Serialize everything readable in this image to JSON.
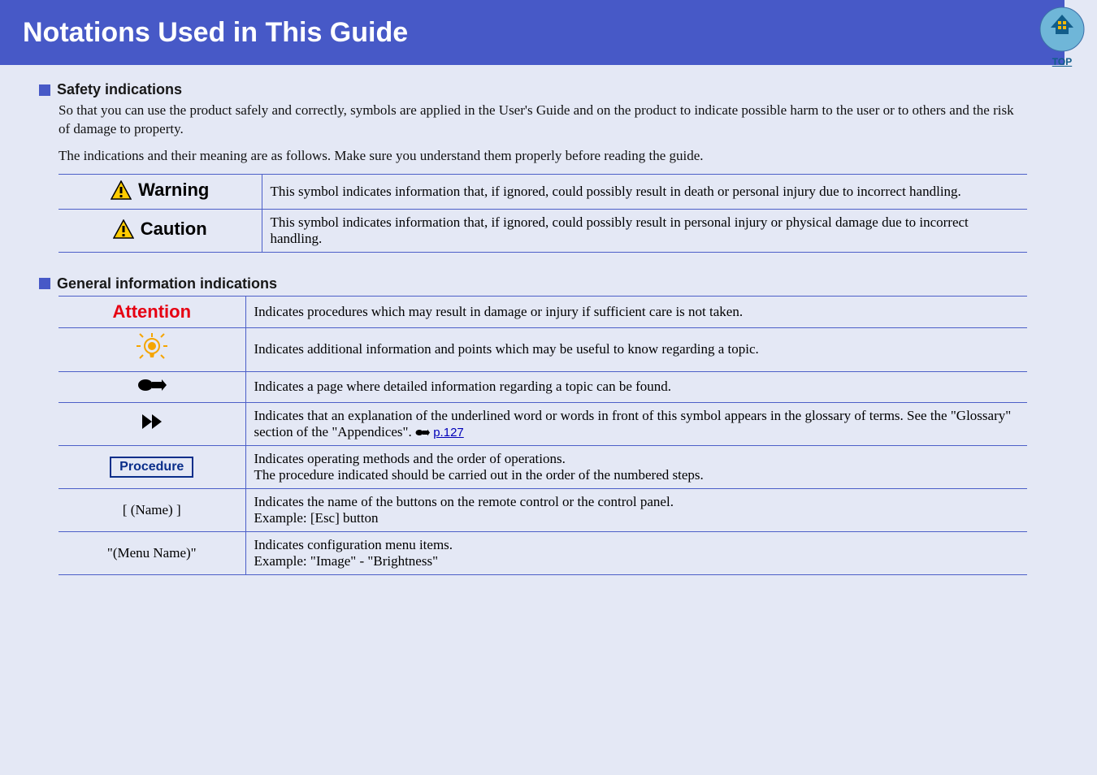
{
  "header": {
    "title": "Notations Used in This Guide"
  },
  "topIcon": {
    "label": "TOP"
  },
  "safety": {
    "heading": "Safety indications",
    "intro1": "So that you can use the product safely and correctly, symbols are applied in the User's Guide and on the product to indicate possible harm to the user or to others and the risk of damage to property.",
    "intro2": "The indications and their meaning are as follows. Make sure you understand them properly before reading the guide.",
    "rows": [
      {
        "label": "Warning",
        "desc": "This symbol indicates information that, if ignored, could possibly result in death or personal injury due to incorrect handling."
      },
      {
        "label": "Caution",
        "desc": "This symbol indicates information that, if ignored, could possibly result in personal injury or physical damage due to incorrect handling."
      }
    ]
  },
  "general": {
    "heading": "General information indications",
    "rows": {
      "attention": {
        "label": "Attention",
        "desc": "Indicates procedures which may result in damage or injury if sufficient care is not taken."
      },
      "tip": {
        "desc": "Indicates additional information and points which may be useful to know regarding a topic."
      },
      "pointer": {
        "desc": "Indicates a page where detailed information regarding a topic can be found."
      },
      "glossary": {
        "desc1": "Indicates that an explanation of the underlined word or words in front of this symbol appears in the glossary of terms. See the \"Glossary\" section of the \"Appendices\". ",
        "link": "p.127"
      },
      "procedure": {
        "label": "Procedure",
        "desc": "Indicates operating methods and the order of operations.\nThe procedure indicated should be carried out in the order of the numbered steps."
      },
      "name": {
        "label": "[ (Name) ]",
        "desc": "Indicates the name of the buttons on the remote control or the control panel.\nExample: [Esc] button"
      },
      "menu": {
        "label": "\"(Menu Name)\"",
        "desc": "Indicates configuration menu items.\nExample: \"Image\" - \"Brightness\""
      }
    }
  }
}
